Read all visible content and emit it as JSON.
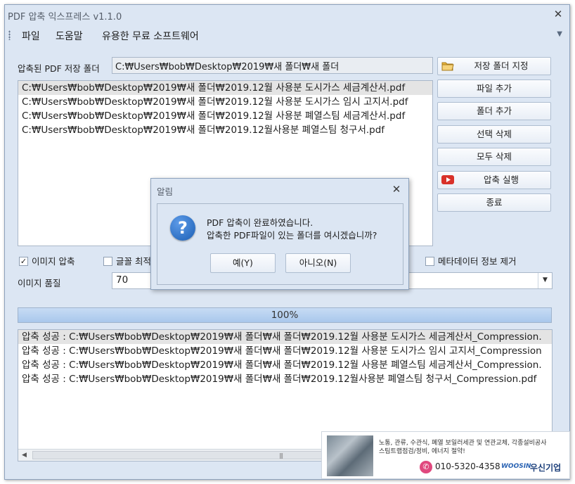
{
  "window": {
    "title": "PDF 압축 익스프레스 v1.1.0",
    "close_glyph": "✕"
  },
  "menu": {
    "items": [
      "파일",
      "도움말",
      "유용한 무료 소프트웨어"
    ],
    "overflow_glyph": "▼"
  },
  "save_folder": {
    "label": "압축된 PDF 저장 폴더",
    "value": "C:₩Users₩bob₩Desktop₩2019₩새 폴더₩새 폴더"
  },
  "file_list": [
    "C:₩Users₩bob₩Desktop₩2019₩새 폴더₩2019.12월 사용분 도시가스 세금계산서.pdf",
    "C:₩Users₩bob₩Desktop₩2019₩새 폴더₩2019.12월 사용분 도시가스 임시 고지서.pdf",
    "C:₩Users₩bob₩Desktop₩2019₩새 폴더₩2019.12월 사용분 폐열스팀 세금계산서.pdf",
    "C:₩Users₩bob₩Desktop₩2019₩새 폴더₩2019.12월사용분 폐열스팀 청구서.pdf"
  ],
  "buttons": {
    "set_folder": "저장 폴더 지정",
    "add_file": "파일 추가",
    "add_folder": "폴더 추가",
    "delete_selected": "선택 삭제",
    "delete_all": "모두 삭제",
    "run_compression": "압축 실행",
    "exit": "종료"
  },
  "options": {
    "compress_images": {
      "label": "이미지 압축",
      "checked": true
    },
    "font_optimize": {
      "label": "글꼴 최적",
      "checked": false
    },
    "remove_metadata": {
      "label": "메타데이터 정보 제거",
      "checked": false
    },
    "image_quality_label": "이미지 품질",
    "image_quality_value": "70"
  },
  "progress": {
    "percent": 100,
    "text": "100%"
  },
  "log": [
    "압축 성공 : C:₩Users₩bob₩Desktop₩2019₩새 폴더₩새 폴더₩2019.12월 사용분 도시가스 세금계산서_Compression.",
    "압축 성공 : C:₩Users₩bob₩Desktop₩2019₩새 폴더₩새 폴더₩2019.12월 사용분 도시가스 임시 고지서_Compression",
    "압축 성공 : C:₩Users₩bob₩Desktop₩2019₩새 폴더₩새 폴더₩2019.12월 사용분 폐열스팀 세금계산서_Compression.",
    "압축 성공 : C:₩Users₩bob₩Desktop₩2019₩새 폴더₩새 폴더₩2019.12월사용분 폐열스팀 청구서_Compression.pdf"
  ],
  "dialog": {
    "title": "알림",
    "close_glyph": "✕",
    "icon_glyph": "?",
    "message_line1": "PDF 압축이 완료하였습니다.",
    "message_line2": "압축한 PDF파일이 있는 폴더를 여시겠습니까?",
    "yes": "예(Y)",
    "no": "아니오(N)"
  },
  "ad": {
    "line1": "노통, 관류, 수관식, 폐열 보일러세관 및 연관교체, 각종설비공사",
    "line2": "스팀트랩점검/정비, 에너지 절약!",
    "phone": "010-5320-4358",
    "brand": "WOOSIN",
    "company": "우신기업"
  },
  "icons": {
    "folder": "folder-icon",
    "play": "play-icon",
    "question": "question-icon",
    "phone": "phone-icon"
  },
  "colors": {
    "window_bg": "#dce6f3",
    "progress_fill": "#a9c8ec",
    "play_red": "#d9322a",
    "folder_yellow": "#e9b53c"
  }
}
